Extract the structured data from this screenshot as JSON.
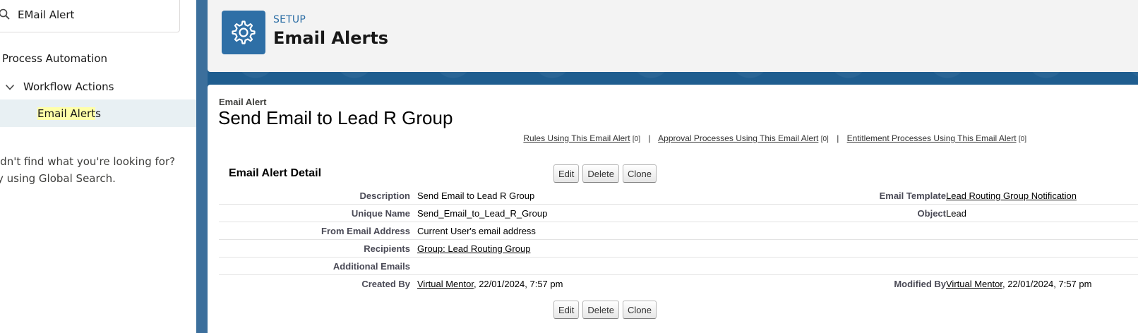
{
  "sidebar": {
    "search_value": "EMail Alert",
    "tree": {
      "process_automation": "Process Automation",
      "workflow_actions": "Workflow Actions",
      "selected_item_highlight": "Email Alert",
      "selected_item_rest": "s"
    },
    "help_line1": "idn't find what you're looking for?",
    "help_line2": "y using Global Search."
  },
  "header": {
    "eyebrow": "SETUP",
    "title": "Email Alerts"
  },
  "record": {
    "type_label": "Email Alert",
    "title": "Send Email to Lead R Group",
    "related_links": [
      {
        "label": "Rules Using This Email Alert",
        "count": "[0]"
      },
      {
        "label": "Approval Processes Using This Email Alert",
        "count": "[0]"
      },
      {
        "label": "Entitlement Processes Using This Email Alert",
        "count": "[0]"
      }
    ],
    "separator": "|",
    "section_title": "Email Alert Detail",
    "buttons": {
      "edit": "Edit",
      "delete": "Delete",
      "clone": "Clone"
    },
    "fields": {
      "description_label": "Description",
      "description_value": "Send Email to Lead R Group",
      "email_template_label": "Email Template",
      "email_template_value": "Lead Routing Group Notification",
      "unique_name_label": "Unique Name",
      "unique_name_value": "Send_Email_to_Lead_R_Group",
      "object_label": "Object",
      "object_value": "Lead",
      "from_email_label": "From Email Address",
      "from_email_value": "Current User's email address",
      "recipients_label": "Recipients",
      "recipients_value": "Group: Lead Routing Group",
      "additional_emails_label": "Additional Emails",
      "additional_emails_value": "",
      "created_by_label": "Created By",
      "created_by_user": "Virtual Mentor",
      "created_by_date": ", 22/01/2024, 7:57 pm",
      "modified_by_label": "Modified By",
      "modified_by_user": "Virtual Mentor",
      "modified_by_date": ", 22/01/2024, 7:57 pm"
    }
  },
  "colors": {
    "setup_blue": "#2e6fa6",
    "selected_row_bg": "#e8f0f3",
    "search_highlight": "#ffffa8",
    "banner_bg": "#1f5d8f"
  }
}
